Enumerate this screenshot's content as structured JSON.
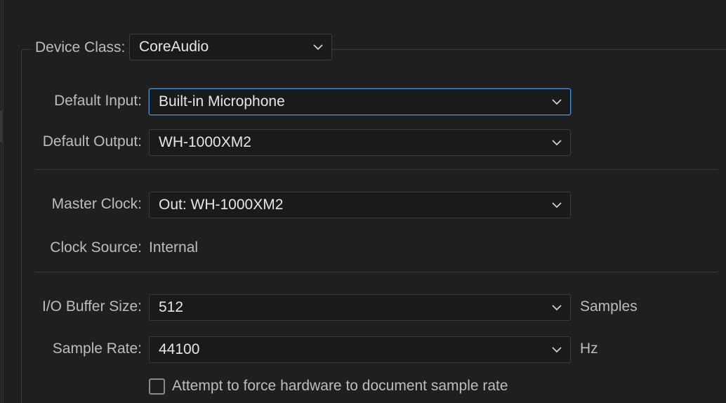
{
  "device_class": {
    "label": "Device Class:",
    "value": "CoreAudio"
  },
  "default_input": {
    "label": "Default Input:",
    "value": "Built-in Microphone"
  },
  "default_output": {
    "label": "Default Output:",
    "value": "WH-1000XM2"
  },
  "master_clock": {
    "label": "Master Clock:",
    "value": "Out: WH-1000XM2"
  },
  "clock_source": {
    "label": "Clock Source:",
    "value": "Internal"
  },
  "io_buffer": {
    "label": "I/O Buffer Size:",
    "value": "512",
    "unit": "Samples"
  },
  "sample_rate": {
    "label": "Sample Rate:",
    "value": "44100",
    "unit": "Hz"
  },
  "force_sample_rate": {
    "label": "Attempt to force hardware to document sample rate",
    "checked": false
  },
  "colors": {
    "background": "#1f1f1f",
    "focus_accent": "#4a8fd8",
    "text": "#bdbdbd",
    "value_text": "#e6e6e6"
  }
}
